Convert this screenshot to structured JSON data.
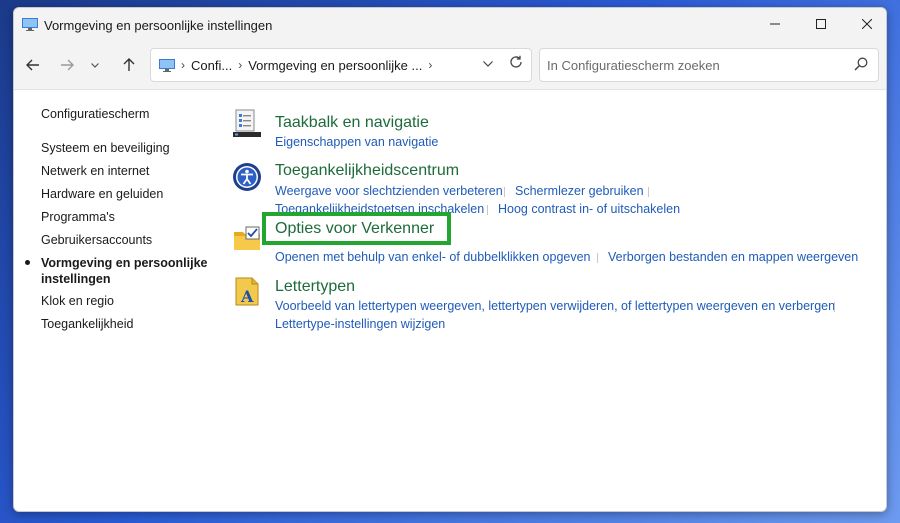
{
  "window": {
    "title": "Vormgeving en persoonlijke instellingen"
  },
  "address": {
    "crumbs": [
      "Confi...",
      "Vormgeving en persoonlijke ..."
    ]
  },
  "search": {
    "placeholder": "In Configuratiescherm zoeken"
  },
  "sidebar": {
    "items": [
      {
        "label": "Configuratiescherm"
      },
      {
        "label": "Systeem en beveiliging"
      },
      {
        "label": "Netwerk en internet"
      },
      {
        "label": "Hardware en geluiden"
      },
      {
        "label": "Programma's"
      },
      {
        "label": "Gebruikersaccounts"
      },
      {
        "label": "Vormgeving en persoonlijke",
        "label2": "instellingen",
        "active": true
      },
      {
        "label": "Klok en regio"
      },
      {
        "label": "Toegankelijkheid"
      }
    ]
  },
  "categories": [
    {
      "title": "Taakbalk en navigatie",
      "icon": "taskbar-icon",
      "links": [
        "Eigenschappen van navigatie"
      ]
    },
    {
      "title": "Toegankelijkheidscentrum",
      "icon": "accessibility-icon",
      "links": [
        "Weergave voor slechtzienden verbeteren",
        "Schermlezer gebruiken",
        "Toegankelijkheidstoetsen inschakelen",
        "Hoog contrast in- of uitschakelen"
      ]
    },
    {
      "title": "Opties voor Verkenner",
      "icon": "folder-options-icon",
      "links": [
        "Openen met behulp van enkel- of dubbelklikken opgeven",
        "Verborgen bestanden en mappen weergeven"
      ]
    },
    {
      "title": "Lettertypen",
      "icon": "fonts-icon",
      "links": [
        "Voorbeeld van lettertypen weergeven, lettertypen verwijderen, of lettertypen weergeven en verbergen",
        "Lettertype-instellingen wijzigen"
      ]
    }
  ],
  "colors": {
    "highlight": "#22a630",
    "category_title": "#1d6b3b",
    "link": "#1f5bb8"
  }
}
